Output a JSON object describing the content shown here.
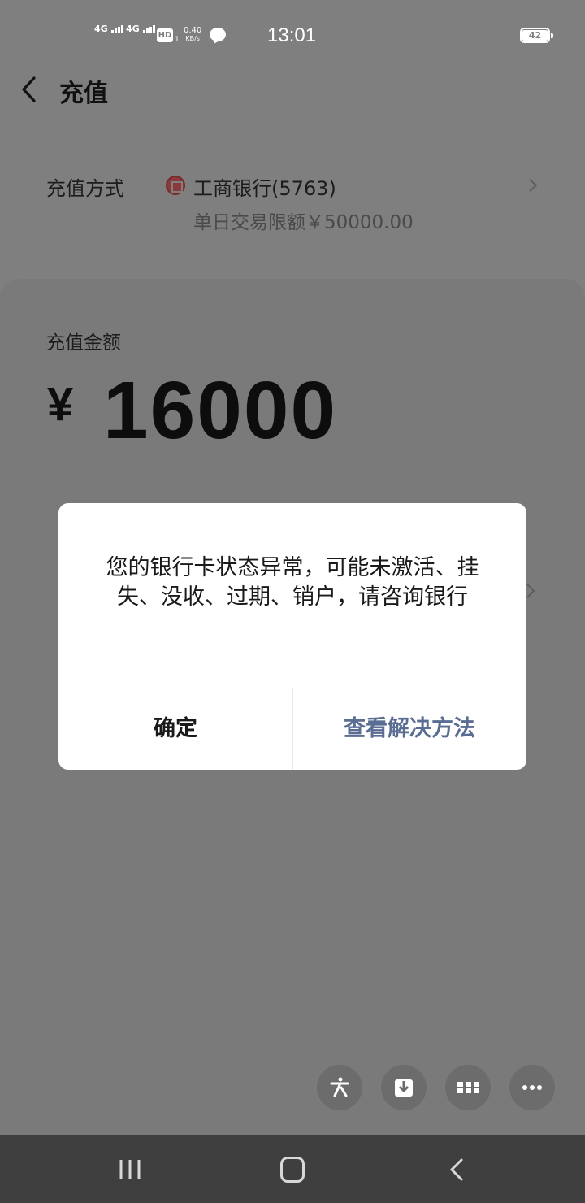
{
  "status_bar": {
    "sim1": "4G",
    "sim2": "4G",
    "hd": "HD",
    "hd_sub": "1",
    "speed_value": "0.40",
    "speed_unit": "KB/s",
    "time": "13:01",
    "battery": "42"
  },
  "header": {
    "title": "充值"
  },
  "payment_method": {
    "label": "充值方式",
    "bank_name": "工商银行(5763)",
    "limit_text": "单日交易限额￥50000.00"
  },
  "amount_section": {
    "label": "充值金额",
    "currency": "¥",
    "amount": "16000"
  },
  "dialog": {
    "message": "您的银行卡状态异常，可能未激活、挂失、没收、过期、销户，请咨询银行",
    "ok_label": "确定",
    "solve_label": "查看解决方法"
  },
  "floating_actions": [
    "accessibility-icon",
    "download-icon",
    "grid-icon",
    "more-icon"
  ],
  "nav_bar": [
    "recent-apps-icon",
    "home-icon",
    "back-icon"
  ]
}
